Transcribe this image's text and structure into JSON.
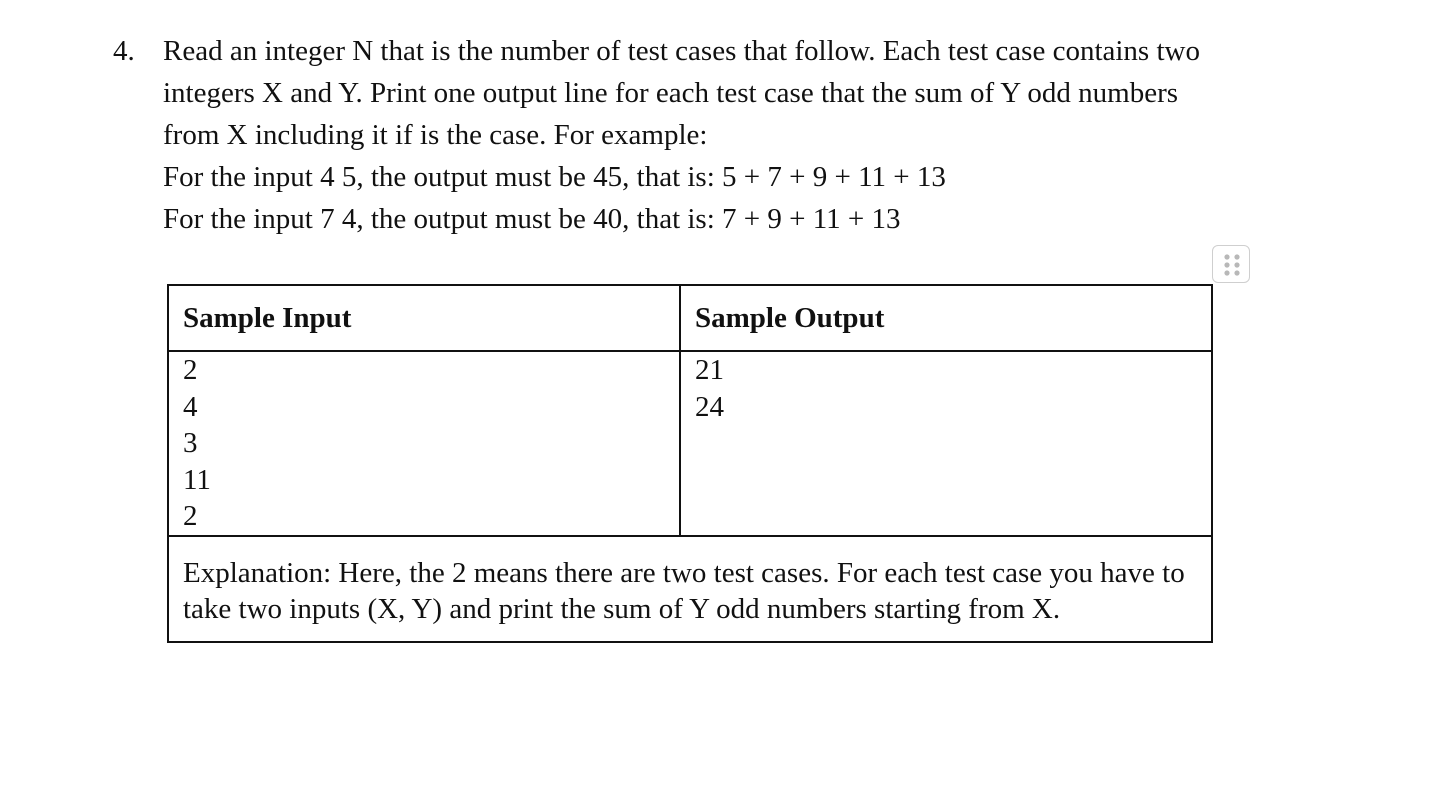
{
  "problem": {
    "number": "4.",
    "lines": [
      "Read an integer N that is the number of test cases that follow. Each test case contains two",
      "integers X and Y. Print one output line for each test case that  the sum of Y odd numbers",
      "from X including it if is the case. For example:",
      "For the input 4 5, the output must be 45, that is: 5 + 7 + 9 + 11 + 13",
      "For the input 7 4, the output must be 40, that is: 7 + 9 + 11 + 13"
    ]
  },
  "table_handle_icon": "drag-handle-icon",
  "sample_table": {
    "headers": [
      "Sample Input",
      "Sample Output"
    ],
    "input_lines": [
      "2",
      "4",
      "3",
      "11",
      "2"
    ],
    "output_lines": [
      "21",
      "24"
    ],
    "explanation": "Explanation: Here, the 2 means there are two test cases. For each test case you have to take two inputs (X, Y) and print the sum of Y odd numbers starting from X."
  }
}
